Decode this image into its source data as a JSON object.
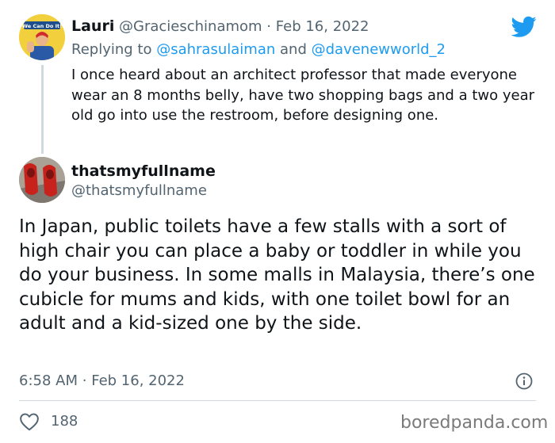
{
  "reply_tweet": {
    "avatar_badge": "We Can Do It!",
    "name": "Lauri",
    "handle": "@Gracieschinamom",
    "separator": "·",
    "date": "Feb 16, 2022",
    "replying_label": "Replying to",
    "reply_to_1": "@sahrasulaiman",
    "reply_and": "and",
    "reply_to_2": "@davenewworld_2",
    "text": "I once heard about an architect professor that made everyone wear an 8 months belly, have two shopping bags and a two year old go into use the restroom, before designing one."
  },
  "main_tweet": {
    "name": "thatsmyfullname",
    "handle": "@thatsmyfullname",
    "text": "In Japan, public toilets have a few stalls with a sort of high chair you can place a baby or toddler in while you do your business. In some malls in Malaysia, there’s one cubicle for mums and kids, with one toilet bowl for an adult and a kid-sized one by the side.",
    "time": "6:58 AM",
    "separator": "·",
    "date": "Feb 16, 2022",
    "like_count": "188"
  },
  "icons": {
    "brand": "twitter-bird-icon",
    "info": "info-icon",
    "like": "heart-icon"
  },
  "colors": {
    "brand_blue": "#1d9bf0",
    "text": "#0f1419",
    "muted": "#536471",
    "divider": "#cfd9de"
  },
  "watermark": "boredpanda.com"
}
